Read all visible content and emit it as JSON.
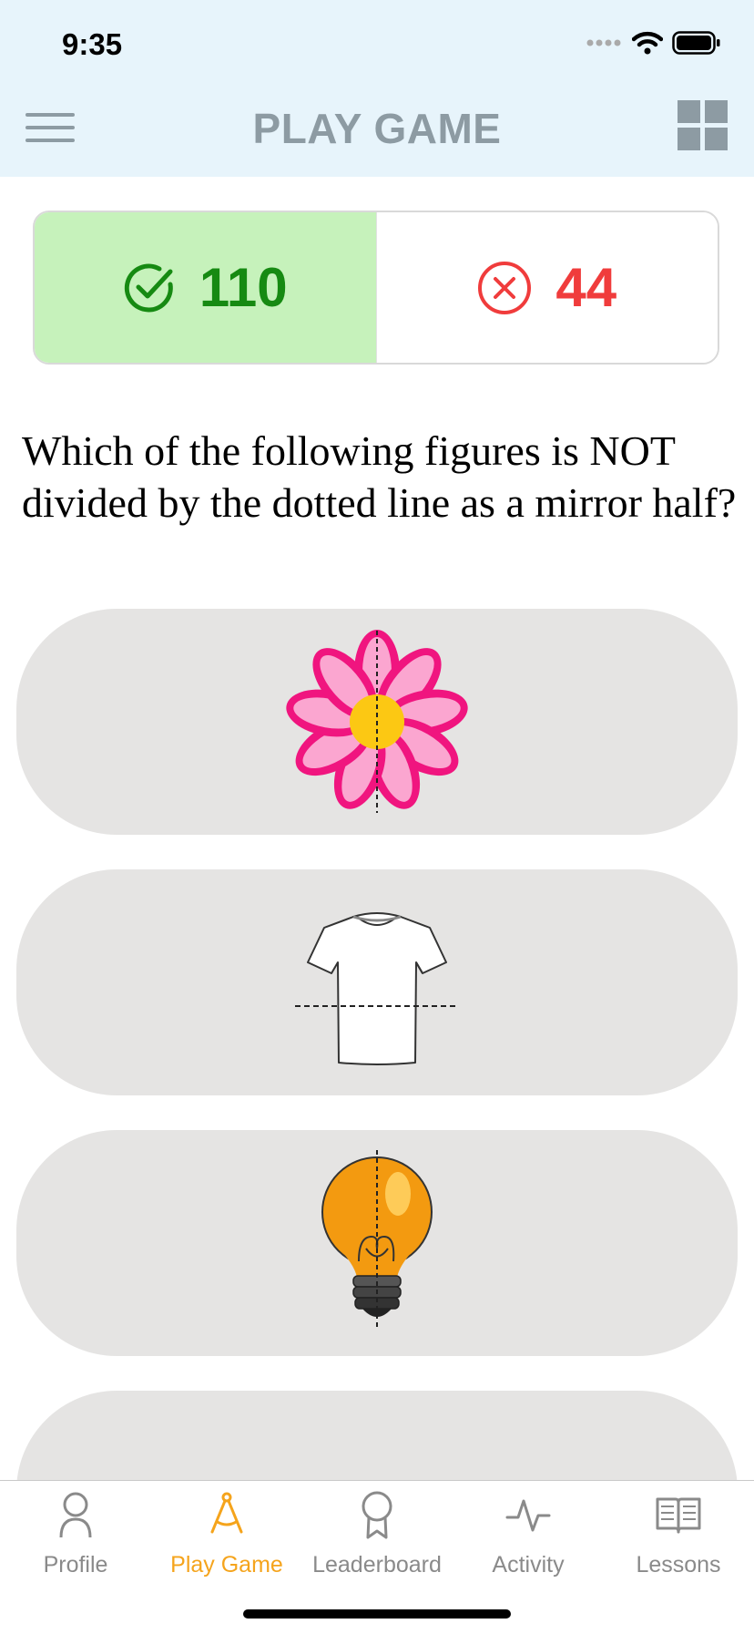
{
  "status_bar": {
    "time": "9:35"
  },
  "nav": {
    "title": "PLAY GAME"
  },
  "score": {
    "correct": "110",
    "wrong": "44"
  },
  "question": {
    "text": "Which of the following figures is NOT divided by the dotted line as a mirror half?"
  },
  "options": [
    {
      "icon": "flower-icon"
    },
    {
      "icon": "tshirt-icon"
    },
    {
      "icon": "lightbulb-icon"
    },
    {
      "icon": ""
    }
  ],
  "tabs": [
    {
      "label": "Profile",
      "icon": "person-icon",
      "active": false
    },
    {
      "label": "Play Game",
      "icon": "compass-icon",
      "active": true
    },
    {
      "label": "Leaderboard",
      "icon": "award-icon",
      "active": false
    },
    {
      "label": "Activity",
      "icon": "activity-icon",
      "active": false
    },
    {
      "label": "Lessons",
      "icon": "book-icon",
      "active": false
    }
  ],
  "colors": {
    "header_bg": "#e7f4fb",
    "correct_bg": "#c6f2bb",
    "correct_text": "#168a12",
    "wrong_text": "#f03c3c",
    "active_tab": "#f5a41c",
    "option_bg": "#e5e4e3"
  }
}
